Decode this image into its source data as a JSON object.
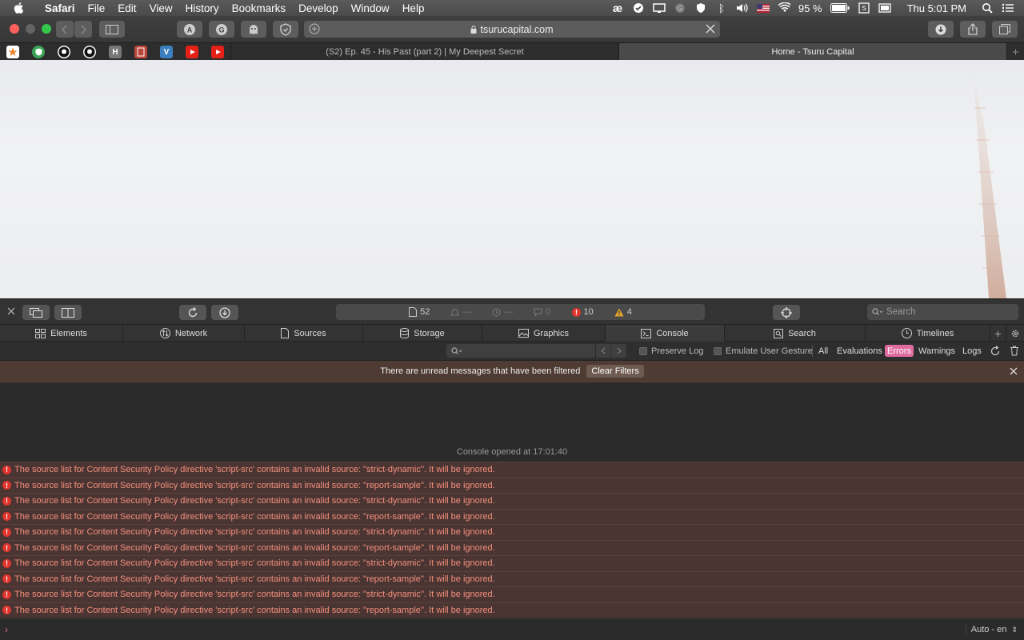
{
  "menubar": {
    "app": "Safari",
    "items": [
      "File",
      "Edit",
      "View",
      "History",
      "Bookmarks",
      "Develop",
      "Window",
      "Help"
    ],
    "battery": "95 %",
    "clock": "Thu 5:01 PM"
  },
  "toolbar": {
    "url": "tsurucapital.com"
  },
  "tabs": [
    {
      "label": "(S2) Ep. 45 - His Past (part 2) | My Deepest Secret"
    },
    {
      "label": "Home - Tsuru Capital"
    }
  ],
  "bookmarks": [
    {
      "icon": "star-icon",
      "text": "",
      "color": "#e8832a"
    },
    {
      "icon": "shield-icon",
      "text": "",
      "color": "#3aa559"
    },
    {
      "icon": "github-icon",
      "text": "",
      "color": "#111111"
    },
    {
      "icon": "github-icon",
      "text": "",
      "color": "#111111"
    },
    {
      "icon": "h-icon",
      "text": "H",
      "color": "#777777"
    },
    {
      "icon": "book-icon",
      "text": "",
      "color": "#b84638"
    },
    {
      "icon": "v-icon",
      "text": "V",
      "color": "#3b7fbf"
    },
    {
      "icon": "youtube-icon",
      "text": "",
      "color": "#e62117"
    },
    {
      "icon": "youtube-icon",
      "text": "",
      "color": "#e62117"
    }
  ],
  "devtools": {
    "status": {
      "resources": "52",
      "transfer": "—",
      "time": "—",
      "logs": "0",
      "errors": "10",
      "warnings": "4"
    },
    "search_placeholder": "Search",
    "tabs": [
      "Elements",
      "Network",
      "Sources",
      "Storage",
      "Graphics",
      "Console",
      "Search",
      "Timelines"
    ],
    "active_tab": "Console",
    "filter": {
      "preserve_log": "Preserve Log",
      "emulate_gesture": "Emulate User Gesture",
      "levels": [
        "All",
        "Evaluations",
        "Errors",
        "Warnings",
        "Logs"
      ],
      "active_level": "Errors"
    },
    "banner": {
      "text": "There are unread messages that have been filtered",
      "button": "Clear Filters"
    },
    "console": {
      "opened": "Console opened at 17:01:40",
      "messages": [
        "The source list for Content Security Policy directive 'script-src' contains an invalid source: ''strict-dynamic''. It will be ignored.",
        "The source list for Content Security Policy directive 'script-src' contains an invalid source: ''report-sample''. It will be ignored.",
        "The source list for Content Security Policy directive 'script-src' contains an invalid source: ''strict-dynamic''. It will be ignored.",
        "The source list for Content Security Policy directive 'script-src' contains an invalid source: ''report-sample''. It will be ignored.",
        "The source list for Content Security Policy directive 'script-src' contains an invalid source: ''strict-dynamic''. It will be ignored.",
        "The source list for Content Security Policy directive 'script-src' contains an invalid source: ''report-sample''. It will be ignored.",
        "The source list for Content Security Policy directive 'script-src' contains an invalid source: ''strict-dynamic''. It will be ignored.",
        "The source list for Content Security Policy directive 'script-src' contains an invalid source: ''report-sample''. It will be ignored.",
        "The source list for Content Security Policy directive 'script-src' contains an invalid source: ''strict-dynamic''. It will be ignored.",
        "The source list for Content Security Policy directive 'script-src' contains an invalid source: ''report-sample''. It will be ignored."
      ]
    },
    "prompt_language": "Auto - en"
  }
}
